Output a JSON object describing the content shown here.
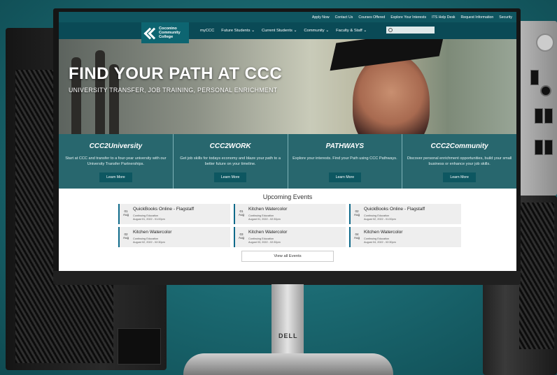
{
  "topbar": {
    "links": [
      "Apply Now",
      "Contact Us",
      "Courses Offered",
      "Explore Your Interests",
      "ITS Help Desk",
      "Request Information",
      "Security"
    ]
  },
  "logo": {
    "line1": "Coconino",
    "line2": "Community",
    "line3": "College"
  },
  "nav": {
    "items": [
      "myCCC",
      "Future Students ⌄",
      "Current Students ⌄",
      "Community ⌄",
      "Faculty & Staff ⌄"
    ]
  },
  "hero": {
    "title": "FIND YOUR PATH AT CCC",
    "subtitle": "UNIVERSITY TRANSFER, JOB TRAINING, PERSONAL ENRICHMENT"
  },
  "panels": [
    {
      "title": "CCC2University",
      "desc": "Start at CCC and transfer to a four-year university with our University Transfer Partnerships.",
      "button": "Learn More"
    },
    {
      "title": "CCC2WORK",
      "desc": "Get job skills for todays economy and blaze your path to a better future on your timeline.",
      "button": "Learn More"
    },
    {
      "title": "PATHWAYS",
      "desc": "Explore your interests. Find your Path using CCC Pathways.",
      "button": "Learn More"
    },
    {
      "title": "CCC2Community",
      "desc": "Discover personal enrichment opportunities, build your small business or enhance your job skills.",
      "button": "Learn More"
    }
  ],
  "events": {
    "heading": "Upcoming Events",
    "items": [
      {
        "day": "01",
        "month": "Aug",
        "title": "QuickBooks Online - Flagstaff",
        "category": "Continuing Education",
        "time": "August 01, 2022 - 01:00pm"
      },
      {
        "day": "01",
        "month": "Aug",
        "title": "Kitchen Watercolor",
        "category": "Continuing Education",
        "time": "August 01, 2022 - 02:30pm"
      },
      {
        "day": "02",
        "month": "Aug",
        "title": "QuickBooks Online - Flagstaff",
        "category": "Continuing Education",
        "time": "August 02, 2022 - 01:00pm"
      },
      {
        "day": "02",
        "month": "Aug",
        "title": "Kitchen Watercolor",
        "category": "Continuing Education",
        "time": "August 02, 2022 - 02:30pm"
      },
      {
        "day": "03",
        "month": "Aug",
        "title": "Kitchen Watercolor",
        "category": "Continuing Education",
        "time": "August 03, 2022 - 02:30pm"
      },
      {
        "day": "04",
        "month": "Aug",
        "title": "Kitchen Watercolor",
        "category": "Continuing Education",
        "time": "August 04, 2022 - 02:30pm"
      }
    ],
    "view_all": "View all Events"
  },
  "monitor": {
    "brand": "DELL"
  },
  "colors": {
    "teal_dark": "#0a4a56",
    "teal_panel": "#165a62",
    "accent_blue": "#0f6a8a"
  }
}
